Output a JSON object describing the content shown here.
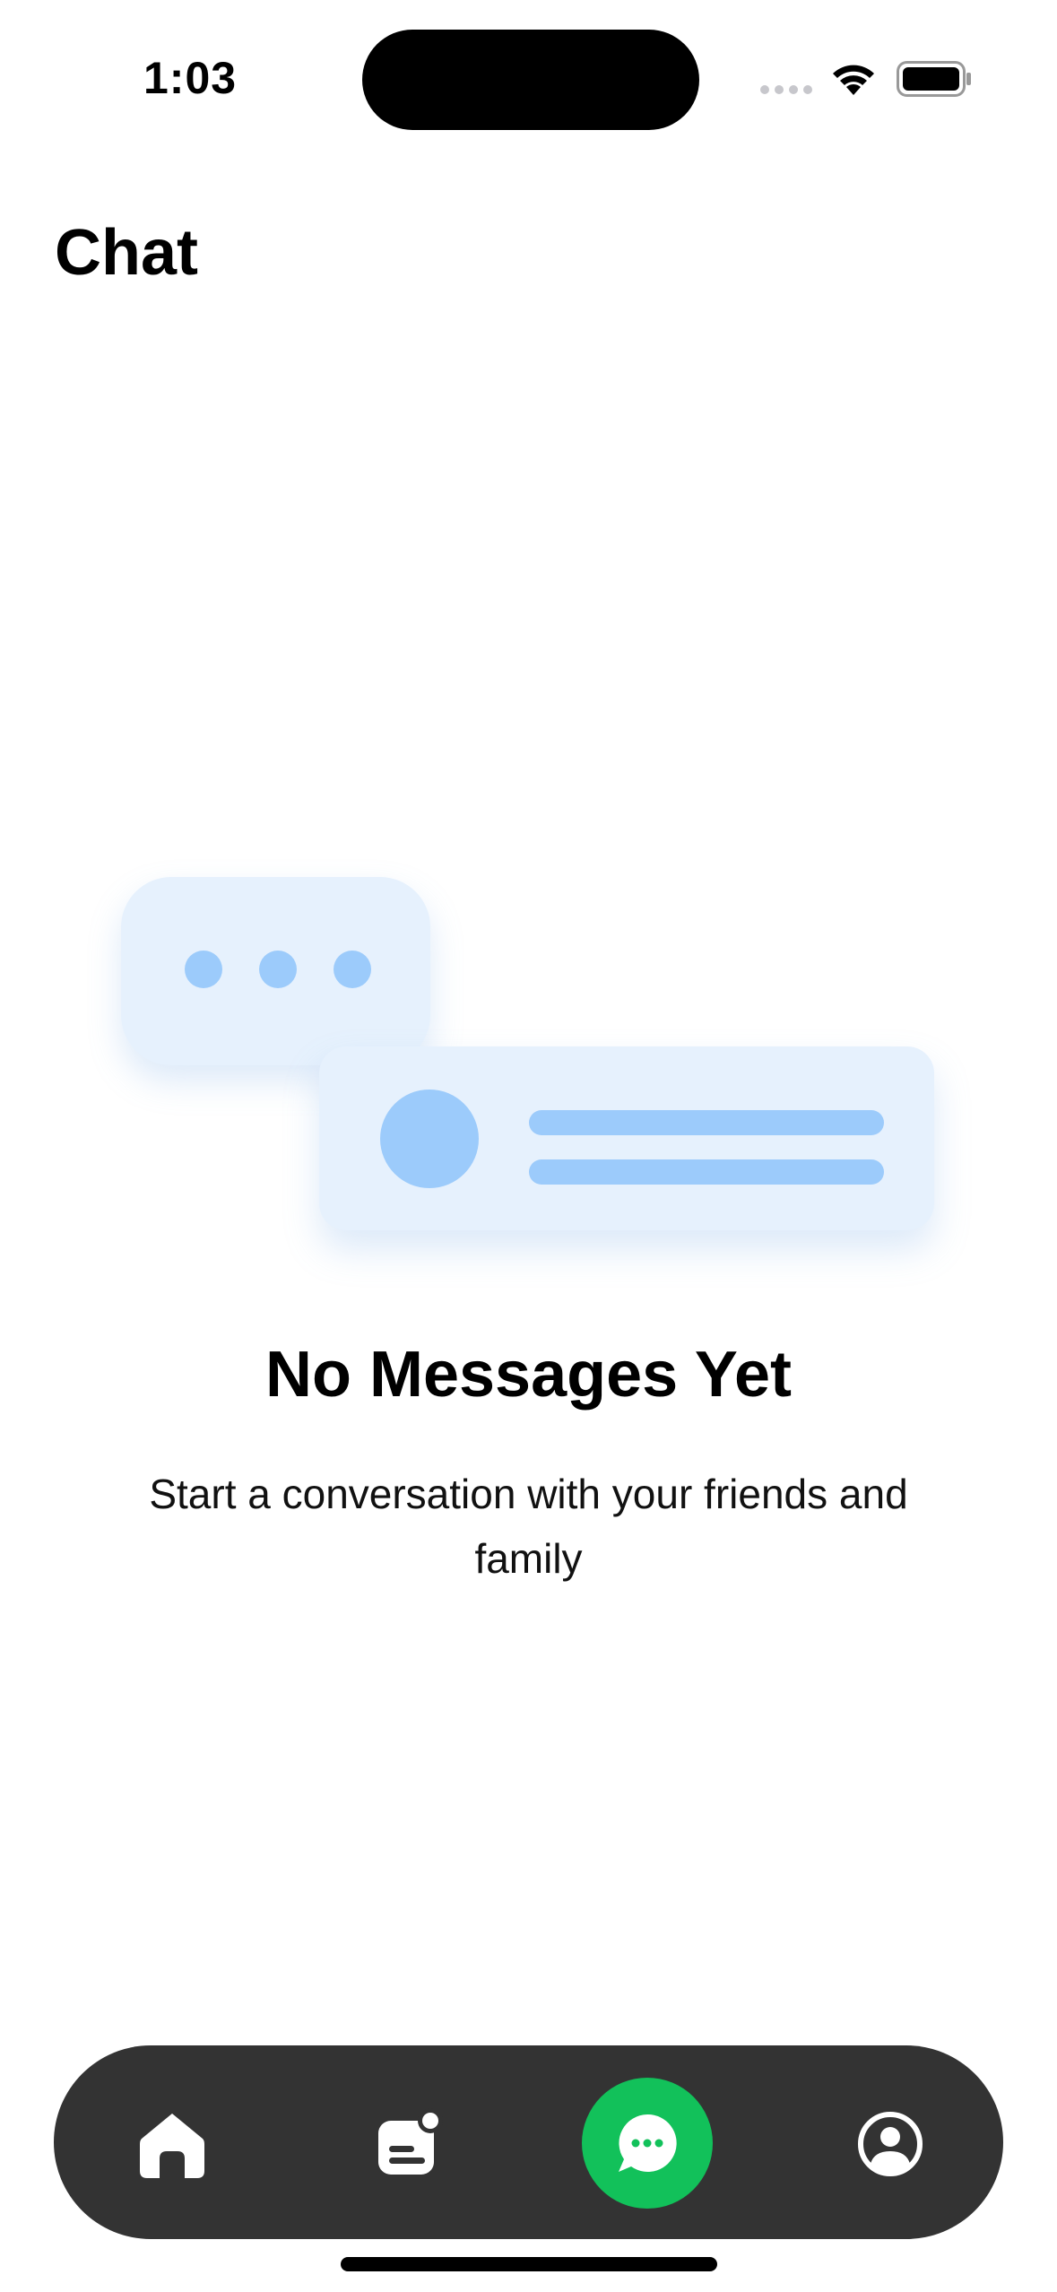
{
  "status_bar": {
    "time": "1:03"
  },
  "header": {
    "title": "Chat"
  },
  "empty_state": {
    "title": "No Messages Yet",
    "subtitle": "Start a conversation with your friends and family"
  },
  "bottom_nav": {
    "items": [
      {
        "icon": "home-icon",
        "active": false
      },
      {
        "icon": "feed-icon",
        "active": false
      },
      {
        "icon": "chat-icon",
        "active": true
      },
      {
        "icon": "profile-icon",
        "active": false
      }
    ]
  },
  "colors": {
    "accent": "#12c15a",
    "nav_background": "#333333",
    "illustration_light": "#e6f1fd",
    "illustration_mid": "#9ccbfb"
  }
}
